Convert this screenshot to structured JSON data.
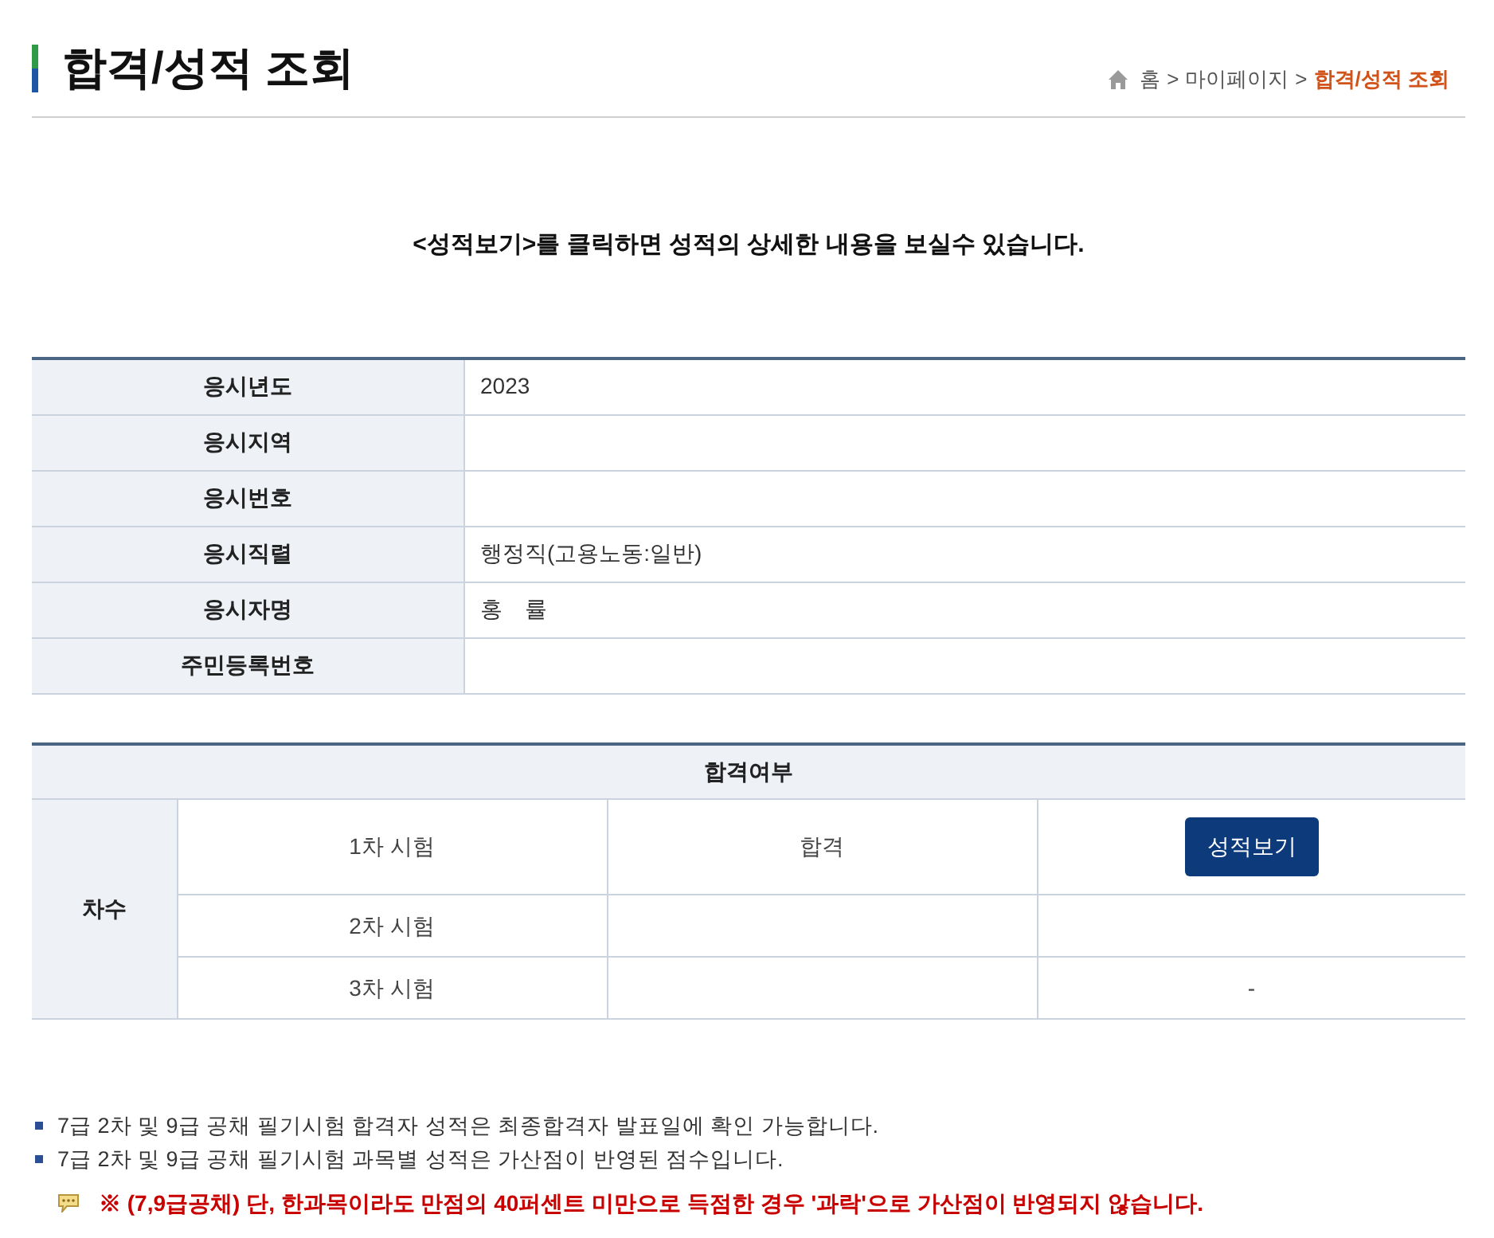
{
  "page_title": "합격/성적 조회",
  "breadcrumb": [
    {
      "kind": "link",
      "label": "홈",
      "current": false
    },
    {
      "kind": "separator",
      "label": ">"
    },
    {
      "kind": "link",
      "label": "마이페이지",
      "current": false
    },
    {
      "kind": "separator",
      "label": ">"
    },
    {
      "kind": "link",
      "label": "합격/성적 조회",
      "current": true
    }
  ],
  "intro": "<성적보기>를 클릭하면 성적의 상세한 내용을 보실수 있습니다.",
  "applicant_info": {
    "rows": [
      {
        "label": "응시년도",
        "value": "2023"
      },
      {
        "label": "응시지역"
      },
      {
        "label": "응시번호"
      },
      {
        "label": "응시직렬",
        "value": "행정직(고용노동:일반)"
      },
      {
        "label": "응시자명",
        "value": "홍　률"
      },
      {
        "label": "주민등록번호"
      }
    ]
  },
  "result_table": {
    "header": "합격여부",
    "row_group_label": "차수",
    "rows": [
      {
        "round": "1차 시험",
        "result": "합격",
        "action": {
          "kind": "button",
          "label": "성적보기"
        }
      },
      {
        "round": "2차 시험"
      },
      {
        "round": "3차 시험",
        "action": {
          "kind": "text",
          "label": "-"
        }
      }
    ]
  },
  "notes": [
    "7급 2차 및 9급 공채 필기시험 합격자 성적은 최종합격자 발표일에 확인 가능합니다.",
    "7급 2차 및 9급 공채 필기시험 과목별 성적은 가산점이 반영된 점수입니다."
  ],
  "warning": "※ (7,9급공채) 단, 한과목이라도 만점의 40퍼센트 미만으로 득점한 경우 '과락'으로 가산점이 반영되지 않습니다."
}
